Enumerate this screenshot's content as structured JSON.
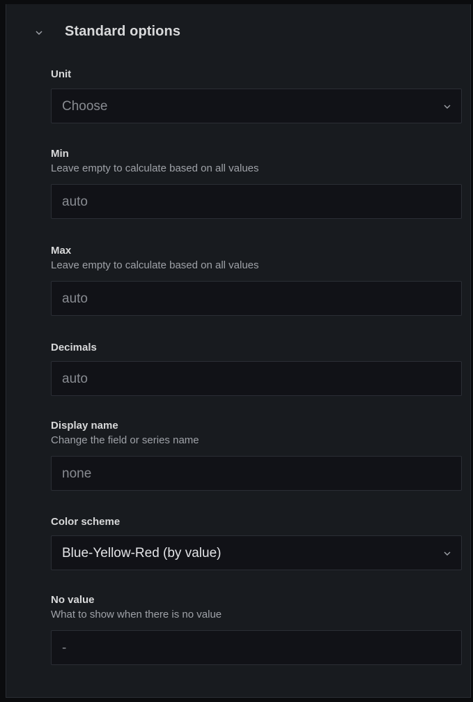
{
  "section": {
    "title": "Standard options",
    "toggle_icon": "chevron-down-icon"
  },
  "unit": {
    "label": "Unit",
    "placeholder": "Choose"
  },
  "min": {
    "label": "Min",
    "description": "Leave empty to calculate based on all values",
    "placeholder": "auto"
  },
  "max": {
    "label": "Max",
    "description": "Leave empty to calculate based on all values",
    "placeholder": "auto"
  },
  "decimals": {
    "label": "Decimals",
    "placeholder": "auto"
  },
  "display_name": {
    "label": "Display name",
    "description": "Change the field or series name",
    "placeholder": "none"
  },
  "color_scheme": {
    "label": "Color scheme",
    "value": "Blue-Yellow-Red (by value)"
  },
  "no_value": {
    "label": "No value",
    "description": "What to show when there is no value",
    "placeholder": "-"
  },
  "colors": {
    "panel_bg": "#181b1f",
    "input_bg": "#111217",
    "label": "#d8d9da",
    "muted": "#9fa2a8"
  }
}
